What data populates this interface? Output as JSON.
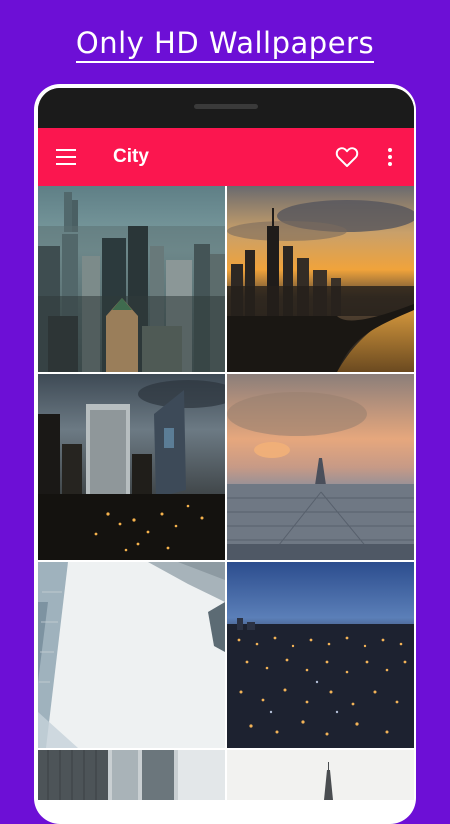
{
  "promo": {
    "title": "Only HD Wallpapers"
  },
  "appbar": {
    "title": "City",
    "menu_icon": "hamburger-menu-icon",
    "favorite_icon": "heart-outline-icon",
    "more_icon": "more-vertical-icon"
  },
  "colors": {
    "background": "#6d0fd6",
    "appbar": "#fb164f",
    "status_bar": "#1b1b1b"
  },
  "wallpapers": [
    {
      "subject": "foggy-skyscrapers-aerial"
    },
    {
      "subject": "sunset-skyline-lakefront"
    },
    {
      "subject": "night-towers-twilight"
    },
    {
      "subject": "sunset-city-tower-haze"
    },
    {
      "subject": "looking-up-skyscrapers-white-sky"
    },
    {
      "subject": "city-lights-at-dusk"
    },
    {
      "subject": "glass-buildings-partial"
    },
    {
      "subject": "white-sky-spire-partial"
    }
  ]
}
